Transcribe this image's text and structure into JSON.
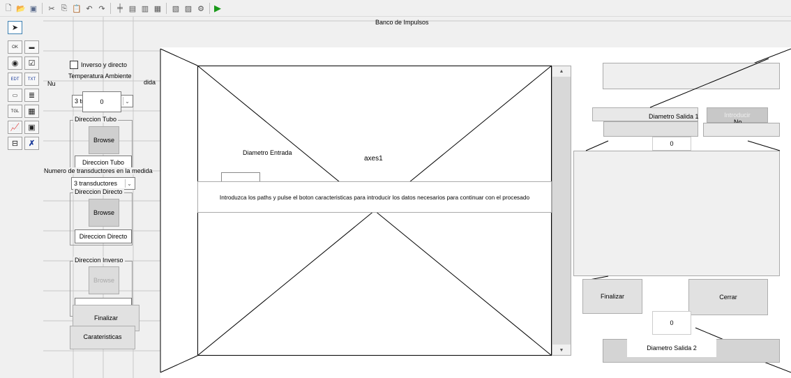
{
  "toolbar": {
    "icons": [
      "new-file-icon",
      "open-folder-icon",
      "save-icon",
      "cut-icon",
      "copy-icon",
      "paste-icon",
      "undo-icon",
      "redo-icon",
      "align-icon",
      "menu-editor-icon",
      "tab-order-icon",
      "toolbar-editor-icon",
      "m-file-editor-icon",
      "property-inspector-icon",
      "object-browser-icon",
      "run-icon"
    ]
  },
  "palette": {
    "tools": [
      "select-tool-icon",
      "push-button-icon",
      "slider-icon",
      "radio-button-icon",
      "checkbox-icon",
      "edit-text-icon",
      "static-text-icon",
      "popup-menu-icon",
      "listbox-icon",
      "toggle-button-icon",
      "table-icon",
      "axes-icon",
      "panel-icon",
      "button-group-icon",
      "activex-icon"
    ],
    "glyphs": [
      "➤",
      "OK",
      "▬",
      "◉",
      "☑",
      "EDT",
      "TXT",
      "▭",
      "≣",
      "TGL",
      "▦",
      "📈",
      "▣",
      "⊟",
      "✗"
    ]
  },
  "canvas": {
    "title": "Banco de Impulsos",
    "checkbox_label": "Inverso y directo",
    "temp_label": "Temperatura Ambiente",
    "temp_value": "0",
    "nu_label": "Nu",
    "dida_label": "dida",
    "popup_small": "3 tr",
    "group_tubo_title": "Direccion Tubo",
    "browse_label": "Browse",
    "direccion_tubo_value": "Direccion Tubo",
    "transductores_label": "Numero de transductores en la medida",
    "transductores_popup": "3 transductores",
    "group_directo_title": "Direccion Directo",
    "direccion_directo_value": "Direccion Directo",
    "group_inverso_title": "Direccion Inverso",
    "finalizar_label": "Finalizar",
    "carateristicas_label": "Carateristicas",
    "diametro_entrada_label": "Diametro Entrada",
    "axes_label": "axes1",
    "info_message": "Introduzca los paths y pulse el boton caracteristicas para introducir los datos necesarios para continuar con el procesado",
    "diametro_salida1_label": "Diametro Salida 1",
    "introducir_label": "Introducir",
    "no_label": "No",
    "salida1_value": "0",
    "finalizar_right_label": "Finalizar",
    "cerrar_label": "Cerrar",
    "salida2_value": "0",
    "diametro_salida2_label": "Diametro Salida 2"
  }
}
